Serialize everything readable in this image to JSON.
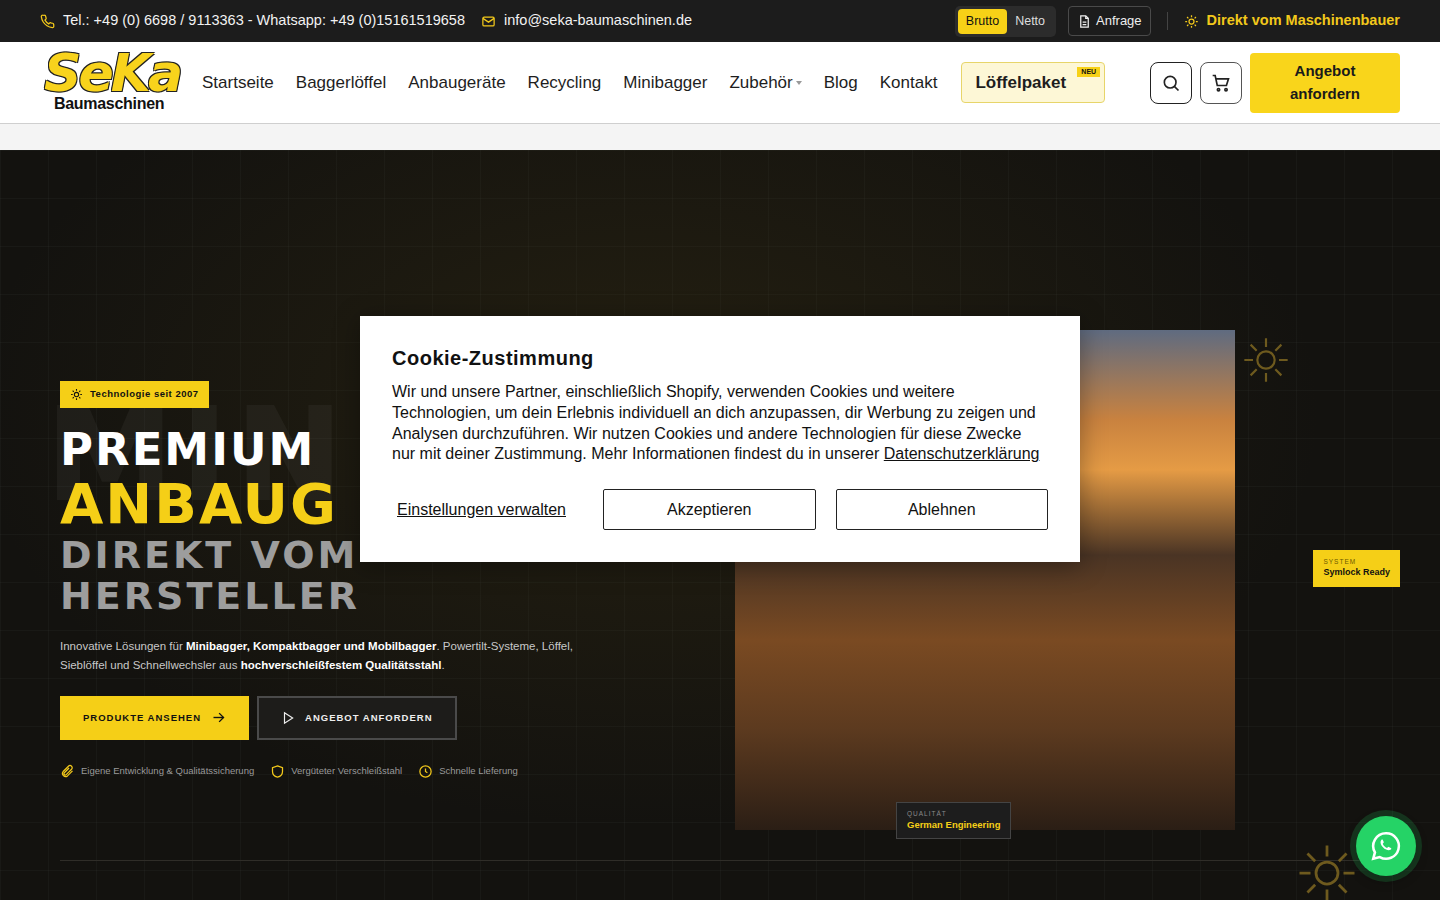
{
  "topbar": {
    "contact": "Tel.: +49 (0) 6698 / 9113363 - Whatsapp: +49 (0)15161519658",
    "email": "info@seka-baumaschinen.de",
    "price_modes": [
      {
        "label": "Brutto",
        "selected": true
      },
      {
        "label": "Netto",
        "selected": false
      }
    ],
    "request": "Anfrage",
    "tagline": "Direkt vom Maschinenbauer"
  },
  "logo": {
    "mark": "SeKa",
    "sub": "Baumaschinen"
  },
  "nav": {
    "items": [
      {
        "label": "Startseite",
        "dropdown": false
      },
      {
        "label": "Baggerlöffel",
        "dropdown": false
      },
      {
        "label": "Anbaugeräte",
        "dropdown": false
      },
      {
        "label": "Recycling",
        "dropdown": false
      },
      {
        "label": "Minibagger",
        "dropdown": false
      },
      {
        "label": "Zubehör",
        "dropdown": true
      },
      {
        "label": "Blog",
        "dropdown": false
      },
      {
        "label": "Kontakt",
        "dropdown": false
      }
    ],
    "special": {
      "label": "Löffelpaket",
      "badge": "NEU"
    },
    "cta": "Angebot anfordern"
  },
  "hero": {
    "watermark": "MINIB",
    "badge": "Technologie seit 2007",
    "headline": [
      {
        "text": "PREMIUM",
        "kind": "primary"
      },
      {
        "text": "ANBAUG",
        "kind": "accent"
      },
      {
        "text": "DIREKT VOM",
        "kind": "muted"
      },
      {
        "text": "HERSTELLER",
        "kind": "muted"
      }
    ],
    "intro": [
      {
        "text": "Innovative Lösungen für ",
        "bold": false
      },
      {
        "text": "Minibagger, Kompaktbagger und Mobilbagger",
        "bold": true
      },
      {
        "text": ". Powertilt-Systeme, Löffel, Sieblöffel und Schnellwechsler aus ",
        "bold": false
      },
      {
        "text": "hochverschleißfestem Qualitätsstahl",
        "bold": true
      },
      {
        "text": ".",
        "bold": false
      }
    ],
    "buttons": [
      {
        "label": "PRODUKTE ANSEHEN",
        "kind": "primary"
      },
      {
        "label": "ANGEBOT ANFORDERN",
        "kind": "outline"
      }
    ],
    "features": [
      "Eigene Entwicklung & Qualitätssicherung",
      "Vergüteter Verschleißstahl",
      "Schnelle Lieferung"
    ],
    "image_tag": {
      "label": "QUALITÄT",
      "value": "German Engineering"
    },
    "side_tag": {
      "label": "SYSTEM",
      "value": "Symlock Ready"
    }
  },
  "cookie": {
    "title": "Cookie-Zustimmung",
    "text": "Wir und unsere Partner, einschließlich Shopify, verwenden Cookies und weitere Technologien, um dein Erlebnis individuell an dich anzupassen, dir Werbung zu zeigen und Analysen durchzuführen. Wir nutzen Cookies und andere Technologien für diese Zwecke nur mit deiner Zustimmung. Mehr Informationen findest du in unserer ",
    "link": "Datenschutzerklärung",
    "manage": "Einstellungen verwalten",
    "accept": "Akzeptieren",
    "decline": "Ablehnen"
  }
}
